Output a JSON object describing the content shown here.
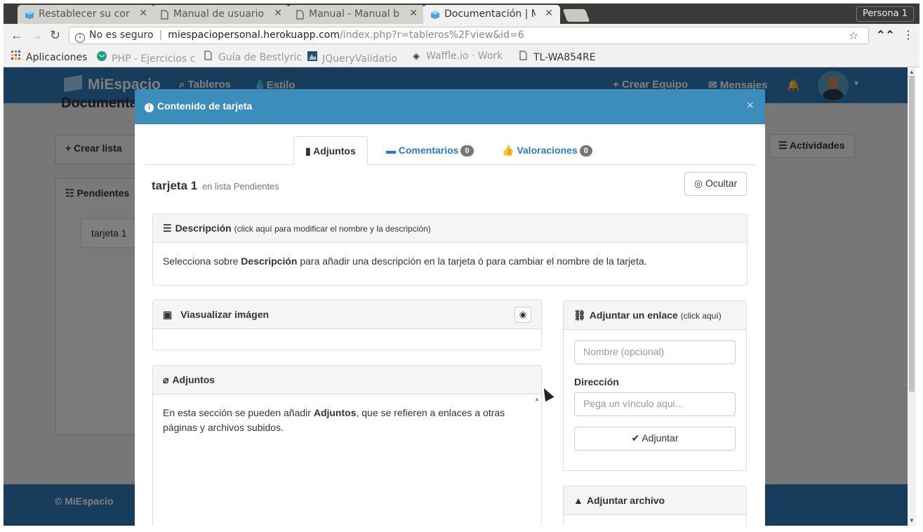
{
  "browser": {
    "tabs": [
      {
        "title": "Restablecer su cont",
        "favicon": "cube-icon",
        "favcolor": "#4aa3df"
      },
      {
        "title": "Manual de usuario",
        "favicon": "page-icon",
        "favcolor": "#777777"
      },
      {
        "title": "Manual - Manual bá",
        "favicon": "page-icon",
        "favcolor": "#777777"
      },
      {
        "title": "Documentación | M",
        "favicon": "cube-icon",
        "favcolor": "#4aa3df"
      }
    ],
    "profile": "Persona 1",
    "security": "No es seguro",
    "url_host": "miespaciopersonal.herokuapp.com",
    "url_path": "/index.php?r=tableros%2Fview&id=6",
    "bookmarks": [
      {
        "label": "Aplicaciones",
        "icon": "apps-grid-icon"
      },
      {
        "label": "PHP - Ejercicios c",
        "icon": "globe-icon"
      },
      {
        "label": "Guía de Bestlyric",
        "icon": "page-icon"
      },
      {
        "label": "JQueryValidatio",
        "icon": "bookmark-image-icon"
      },
      {
        "label": "Waffle.io · Work",
        "icon": "waffle-icon"
      },
      {
        "label": "TL-WA854RE",
        "icon": "page-icon"
      }
    ]
  },
  "app": {
    "brand": "MiEspacio",
    "nav": {
      "boards": "Tableros",
      "style": "Estilo",
      "create_team": "Crear Equipo",
      "messages": "Mensajes"
    },
    "page_title": "Documentación",
    "create_list": "Crear lista",
    "activities": "Actividades",
    "list_title": "Pendientes",
    "card_name": "tarjeta 1",
    "footer": "© MiEspacio",
    "accent": "#3179b7"
  },
  "modal": {
    "title": "Contenido de tarjeta",
    "header_color": "#3c8dbc",
    "tabs": [
      {
        "label": "Adjuntos",
        "badge": ""
      },
      {
        "label": "Comentarios",
        "badge": "0"
      },
      {
        "label": "Valoraciones",
        "badge": "0"
      }
    ],
    "card_title": "tarjeta 1",
    "card_subtitle": "en lista Pendientes",
    "hide_button": "Ocultar",
    "description": {
      "heading": "Descripción",
      "heading_hint": "(click aquí para modificar el nombre y la descripción)",
      "text_before": "Selecciona sobre",
      "text_bold": "Descripción",
      "text_after": "para añadir una descripción en la tarjeta ó para cambiar el nombre de la tarjeta."
    },
    "image_panel": {
      "heading": "Viasualizar imágen"
    },
    "attachments": {
      "heading": "Adjuntos",
      "text_before": "En esta sección se pueden añadir",
      "text_bold": "Adjuntos",
      "text_after": ", que se refieren a enlaces a otras páginas y archivos subidos."
    },
    "link_panel": {
      "heading": "Adjuntar un enlace",
      "heading_hint": "(click aquí)",
      "name_placeholder": "Nombre (opcional)",
      "address_label": "Dirección",
      "address_placeholder": "Pega un vínculo aqui...",
      "submit": "Adjuntar"
    },
    "file_panel": {
      "heading": "Adjuntar archivo"
    }
  }
}
